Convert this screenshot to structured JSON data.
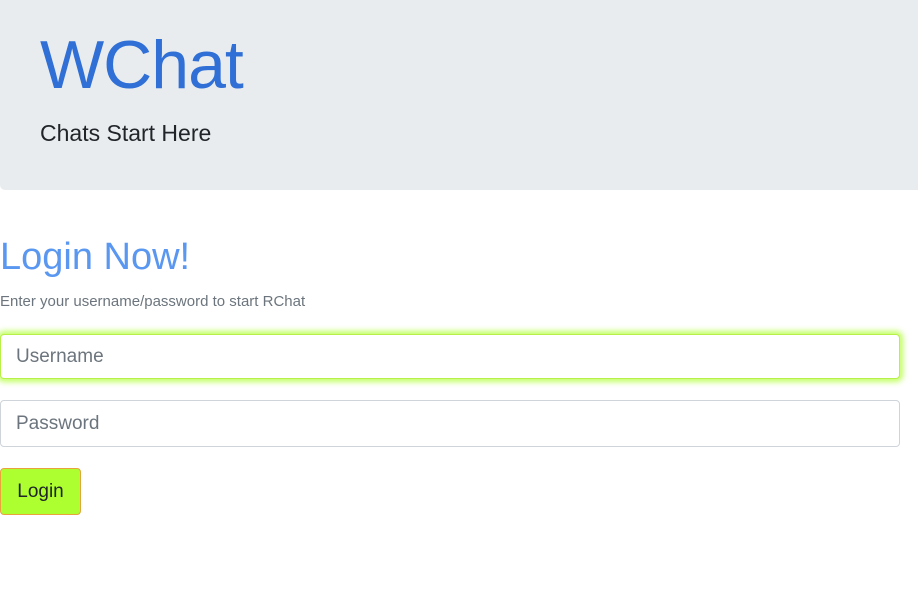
{
  "header": {
    "title": "WChat",
    "tagline": "Chats Start Here"
  },
  "login": {
    "heading": "Login Now!",
    "subtext": "Enter your username/password to start RChat",
    "username_placeholder": "Username",
    "password_placeholder": "Password",
    "submit_label": "Login"
  },
  "colors": {
    "header_background": "#e9ecef",
    "title_color": "#2f6fd6",
    "heading_color": "#5a97f0",
    "button_background": "#adff2f",
    "focus_glow": "#adff2f"
  }
}
